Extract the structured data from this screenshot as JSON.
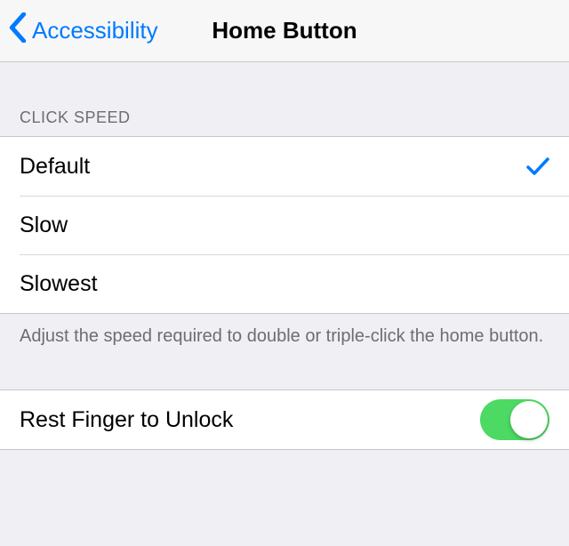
{
  "navbar": {
    "back_label": "Accessibility",
    "title": "Home Button"
  },
  "click_speed": {
    "header": "Click Speed",
    "selected_index": 0,
    "options": [
      {
        "label": "Default"
      },
      {
        "label": "Slow"
      },
      {
        "label": "Slowest"
      }
    ],
    "footer": "Adjust the speed required to double or triple-click the home button."
  },
  "rest_finger": {
    "label": "Rest Finger to Unlock",
    "enabled": true
  },
  "colors": {
    "accent": "#007aff",
    "toggle_on": "#4cd964"
  }
}
